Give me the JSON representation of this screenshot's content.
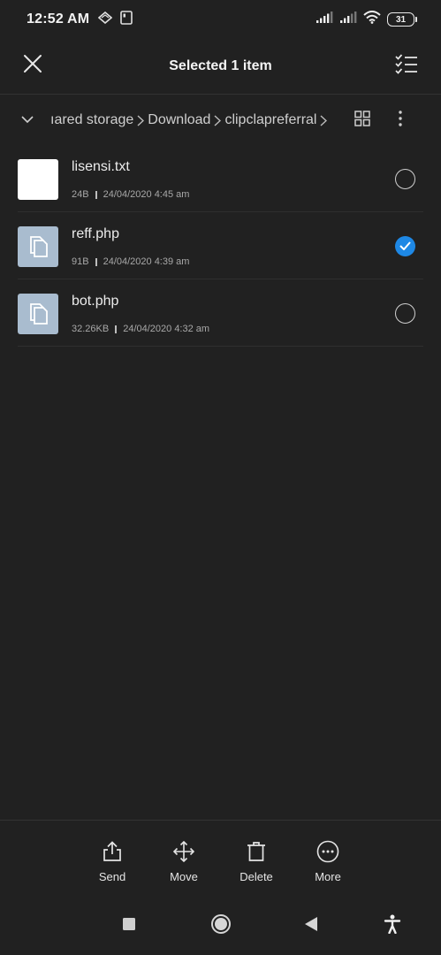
{
  "status_bar": {
    "time": "12:52 AM",
    "battery": "31",
    "left_icons": [
      "data-saver-icon",
      "screenshot-icon"
    ],
    "right_icons": [
      "signal-icon",
      "signal-icon",
      "wifi-icon",
      "battery-icon"
    ]
  },
  "action_bar": {
    "title": "Selected 1 item",
    "close_icon": "close-icon",
    "select_all_icon": "checklist-icon"
  },
  "breadcrumb": {
    "items": [
      "ıared storage",
      "Download",
      "clipclapreferral"
    ]
  },
  "files": [
    {
      "name": "lisensi.txt",
      "size": "24B",
      "date": "24/04/2020 4:45 am",
      "thumb": "white",
      "selected": false
    },
    {
      "name": "reff.php",
      "size": "91B",
      "date": "24/04/2020 4:39 am",
      "thumb": "document-icon",
      "selected": true
    },
    {
      "name": "bot.php",
      "size": "32.26KB",
      "date": "24/04/2020 4:32 am",
      "thumb": "document-icon",
      "selected": false
    }
  ],
  "toolbar": {
    "send_label": "Send",
    "move_label": "Move",
    "delete_label": "Delete",
    "more_label": "More"
  },
  "colors": {
    "background": "#212121",
    "accent": "#1e88e5",
    "doc_thumb": "#a9bccf"
  }
}
